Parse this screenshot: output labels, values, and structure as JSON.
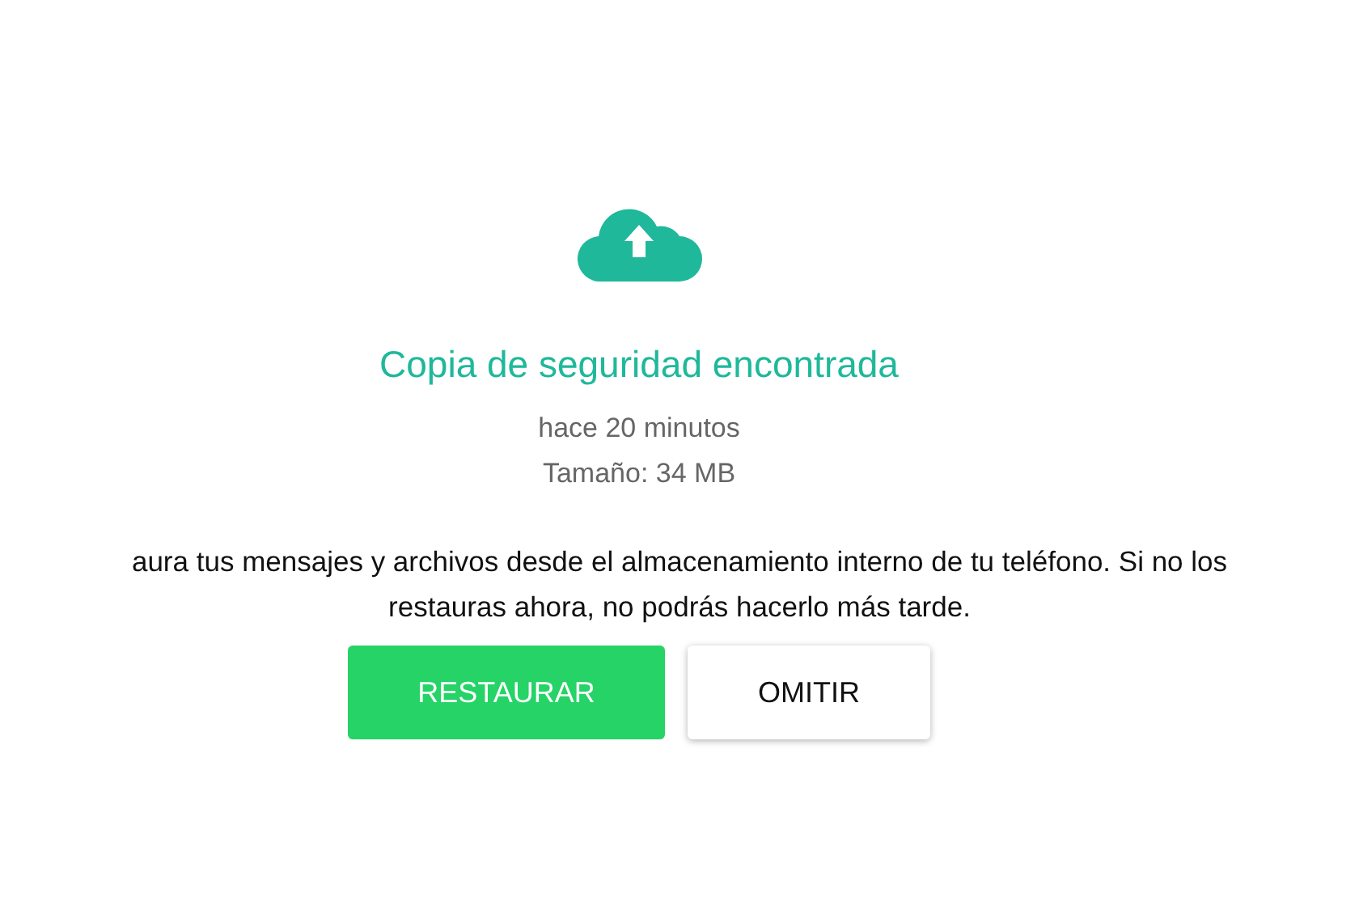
{
  "title": "Copia de seguridad encontrada",
  "details": [
    "hace 20 minutos",
    "Tamaño: 34 MB"
  ],
  "message": "aura tus mensajes y archivos desde el almacenamiento interno de tu teléfono. Si no los\nrestauras ahora, no podrás hacerlo más tarde.",
  "buttons": [
    {
      "label": "RESTAURAR",
      "kind": "primary"
    },
    {
      "label": "OMITIR",
      "kind": "secondary"
    }
  ]
}
